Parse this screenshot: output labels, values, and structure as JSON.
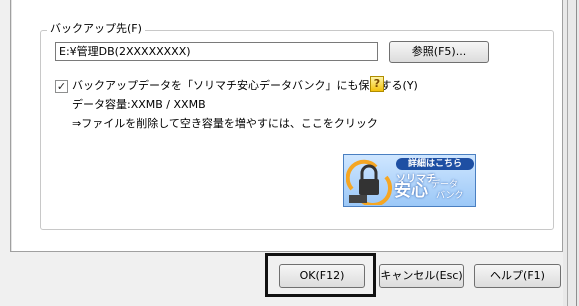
{
  "backup": {
    "group_label": "バックアップ先(F)",
    "path_value": "E:¥管理DB(2XXXXXXXX)",
    "browse_label": "参照(F5)...",
    "also_save_label": "バックアップデータを「ソリマチ安心データバンク」にも保存する(Y)",
    "also_save_checked": true,
    "capacity_text": "データ容量:XXMB / XXMB",
    "free_space_hint": "⇒ファイルを削除して空き容量を増やすには、ここをクリック"
  },
  "banner": {
    "details_badge": "詳細はこちら",
    "brand": "ソリマチ",
    "main": "安心",
    "sub1": "データ",
    "sub2": "バンク"
  },
  "footer": {
    "ok_label": "OK(F12)",
    "cancel_label": "キャンセル(Esc)",
    "help_label": "ヘルプ(F1)"
  },
  "icons": {
    "help": "question-mark-icon",
    "checkbox": "check-icon",
    "banner": "lock-refresh-icon"
  },
  "colors": {
    "accent": "#1e4fa3",
    "banner_bg": "#9cc8f7",
    "help_icon": "#f3c10b"
  }
}
